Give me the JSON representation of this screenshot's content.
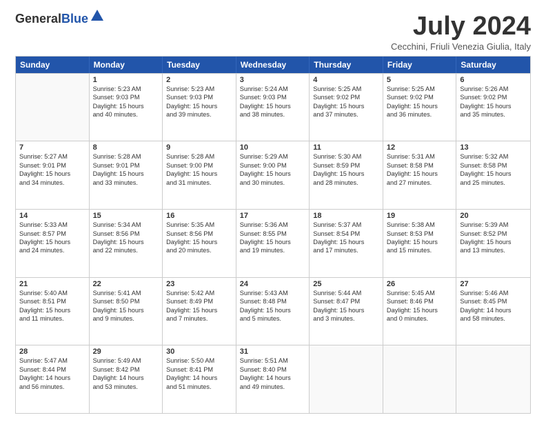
{
  "logo": {
    "general": "General",
    "blue": "Blue"
  },
  "header": {
    "month": "July 2024",
    "location": "Cecchini, Friuli Venezia Giulia, Italy"
  },
  "days": [
    "Sunday",
    "Monday",
    "Tuesday",
    "Wednesday",
    "Thursday",
    "Friday",
    "Saturday"
  ],
  "weeks": [
    [
      {
        "day": "",
        "lines": []
      },
      {
        "day": "1",
        "lines": [
          "Sunrise: 5:23 AM",
          "Sunset: 9:03 PM",
          "Daylight: 15 hours",
          "and 40 minutes."
        ]
      },
      {
        "day": "2",
        "lines": [
          "Sunrise: 5:23 AM",
          "Sunset: 9:03 PM",
          "Daylight: 15 hours",
          "and 39 minutes."
        ]
      },
      {
        "day": "3",
        "lines": [
          "Sunrise: 5:24 AM",
          "Sunset: 9:03 PM",
          "Daylight: 15 hours",
          "and 38 minutes."
        ]
      },
      {
        "day": "4",
        "lines": [
          "Sunrise: 5:25 AM",
          "Sunset: 9:02 PM",
          "Daylight: 15 hours",
          "and 37 minutes."
        ]
      },
      {
        "day": "5",
        "lines": [
          "Sunrise: 5:25 AM",
          "Sunset: 9:02 PM",
          "Daylight: 15 hours",
          "and 36 minutes."
        ]
      },
      {
        "day": "6",
        "lines": [
          "Sunrise: 5:26 AM",
          "Sunset: 9:02 PM",
          "Daylight: 15 hours",
          "and 35 minutes."
        ]
      }
    ],
    [
      {
        "day": "7",
        "lines": [
          "Sunrise: 5:27 AM",
          "Sunset: 9:01 PM",
          "Daylight: 15 hours",
          "and 34 minutes."
        ]
      },
      {
        "day": "8",
        "lines": [
          "Sunrise: 5:28 AM",
          "Sunset: 9:01 PM",
          "Daylight: 15 hours",
          "and 33 minutes."
        ]
      },
      {
        "day": "9",
        "lines": [
          "Sunrise: 5:28 AM",
          "Sunset: 9:00 PM",
          "Daylight: 15 hours",
          "and 31 minutes."
        ]
      },
      {
        "day": "10",
        "lines": [
          "Sunrise: 5:29 AM",
          "Sunset: 9:00 PM",
          "Daylight: 15 hours",
          "and 30 minutes."
        ]
      },
      {
        "day": "11",
        "lines": [
          "Sunrise: 5:30 AM",
          "Sunset: 8:59 PM",
          "Daylight: 15 hours",
          "and 28 minutes."
        ]
      },
      {
        "day": "12",
        "lines": [
          "Sunrise: 5:31 AM",
          "Sunset: 8:58 PM",
          "Daylight: 15 hours",
          "and 27 minutes."
        ]
      },
      {
        "day": "13",
        "lines": [
          "Sunrise: 5:32 AM",
          "Sunset: 8:58 PM",
          "Daylight: 15 hours",
          "and 25 minutes."
        ]
      }
    ],
    [
      {
        "day": "14",
        "lines": [
          "Sunrise: 5:33 AM",
          "Sunset: 8:57 PM",
          "Daylight: 15 hours",
          "and 24 minutes."
        ]
      },
      {
        "day": "15",
        "lines": [
          "Sunrise: 5:34 AM",
          "Sunset: 8:56 PM",
          "Daylight: 15 hours",
          "and 22 minutes."
        ]
      },
      {
        "day": "16",
        "lines": [
          "Sunrise: 5:35 AM",
          "Sunset: 8:56 PM",
          "Daylight: 15 hours",
          "and 20 minutes."
        ]
      },
      {
        "day": "17",
        "lines": [
          "Sunrise: 5:36 AM",
          "Sunset: 8:55 PM",
          "Daylight: 15 hours",
          "and 19 minutes."
        ]
      },
      {
        "day": "18",
        "lines": [
          "Sunrise: 5:37 AM",
          "Sunset: 8:54 PM",
          "Daylight: 15 hours",
          "and 17 minutes."
        ]
      },
      {
        "day": "19",
        "lines": [
          "Sunrise: 5:38 AM",
          "Sunset: 8:53 PM",
          "Daylight: 15 hours",
          "and 15 minutes."
        ]
      },
      {
        "day": "20",
        "lines": [
          "Sunrise: 5:39 AM",
          "Sunset: 8:52 PM",
          "Daylight: 15 hours",
          "and 13 minutes."
        ]
      }
    ],
    [
      {
        "day": "21",
        "lines": [
          "Sunrise: 5:40 AM",
          "Sunset: 8:51 PM",
          "Daylight: 15 hours",
          "and 11 minutes."
        ]
      },
      {
        "day": "22",
        "lines": [
          "Sunrise: 5:41 AM",
          "Sunset: 8:50 PM",
          "Daylight: 15 hours",
          "and 9 minutes."
        ]
      },
      {
        "day": "23",
        "lines": [
          "Sunrise: 5:42 AM",
          "Sunset: 8:49 PM",
          "Daylight: 15 hours",
          "and 7 minutes."
        ]
      },
      {
        "day": "24",
        "lines": [
          "Sunrise: 5:43 AM",
          "Sunset: 8:48 PM",
          "Daylight: 15 hours",
          "and 5 minutes."
        ]
      },
      {
        "day": "25",
        "lines": [
          "Sunrise: 5:44 AM",
          "Sunset: 8:47 PM",
          "Daylight: 15 hours",
          "and 3 minutes."
        ]
      },
      {
        "day": "26",
        "lines": [
          "Sunrise: 5:45 AM",
          "Sunset: 8:46 PM",
          "Daylight: 15 hours",
          "and 0 minutes."
        ]
      },
      {
        "day": "27",
        "lines": [
          "Sunrise: 5:46 AM",
          "Sunset: 8:45 PM",
          "Daylight: 14 hours",
          "and 58 minutes."
        ]
      }
    ],
    [
      {
        "day": "28",
        "lines": [
          "Sunrise: 5:47 AM",
          "Sunset: 8:44 PM",
          "Daylight: 14 hours",
          "and 56 minutes."
        ]
      },
      {
        "day": "29",
        "lines": [
          "Sunrise: 5:49 AM",
          "Sunset: 8:42 PM",
          "Daylight: 14 hours",
          "and 53 minutes."
        ]
      },
      {
        "day": "30",
        "lines": [
          "Sunrise: 5:50 AM",
          "Sunset: 8:41 PM",
          "Daylight: 14 hours",
          "and 51 minutes."
        ]
      },
      {
        "day": "31",
        "lines": [
          "Sunrise: 5:51 AM",
          "Sunset: 8:40 PM",
          "Daylight: 14 hours",
          "and 49 minutes."
        ]
      },
      {
        "day": "",
        "lines": []
      },
      {
        "day": "",
        "lines": []
      },
      {
        "day": "",
        "lines": []
      }
    ]
  ]
}
